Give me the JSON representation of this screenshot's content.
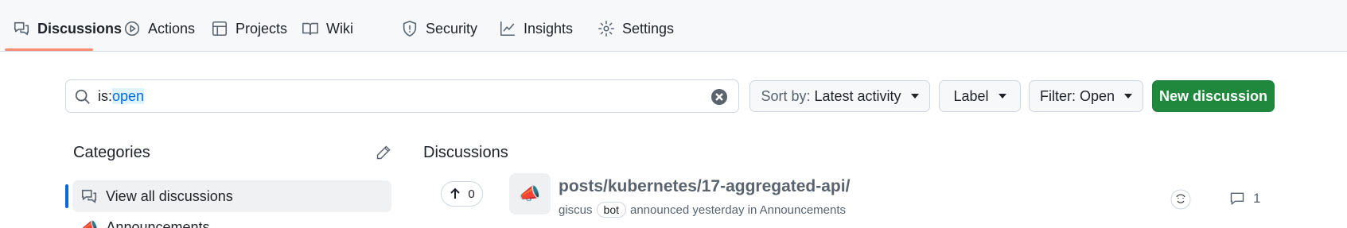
{
  "nav": {
    "tabs": [
      {
        "label": "Discussions",
        "icon": "comment-discussion-icon",
        "active": true
      },
      {
        "label": "Actions",
        "icon": "play-icon"
      },
      {
        "label": "Projects",
        "icon": "table-icon"
      },
      {
        "label": "Wiki",
        "icon": "book-icon"
      },
      {
        "label": "Security",
        "icon": "shield-icon"
      },
      {
        "label": "Insights",
        "icon": "graph-icon"
      },
      {
        "label": "Settings",
        "icon": "gear-icon"
      }
    ]
  },
  "search": {
    "prefix": "is:",
    "value": "open"
  },
  "toolbar": {
    "sort_prefix": "Sort by:",
    "sort_value": "Latest activity",
    "label_button": "Label",
    "filter_button": "Filter: Open",
    "new_discussion": "New discussion"
  },
  "sidebar": {
    "title": "Categories",
    "items": [
      {
        "label": "View all discussions",
        "icon": "comment-discussion-icon"
      },
      {
        "label": "Announcements",
        "icon": "megaphone-icon"
      }
    ]
  },
  "main": {
    "title": "Discussions",
    "discussions": [
      {
        "title": "posts/kubernetes/17-aggregated-api/",
        "votes": "0",
        "author": "giscus",
        "author_badge": "bot",
        "meta": "announced yesterday in Announcements",
        "comments": "1",
        "category_emoji": "📣"
      }
    ]
  },
  "colors": {
    "accent_tab": "#fd8c73",
    "primary_button": "#1f883d",
    "link_active": "#0969da"
  }
}
